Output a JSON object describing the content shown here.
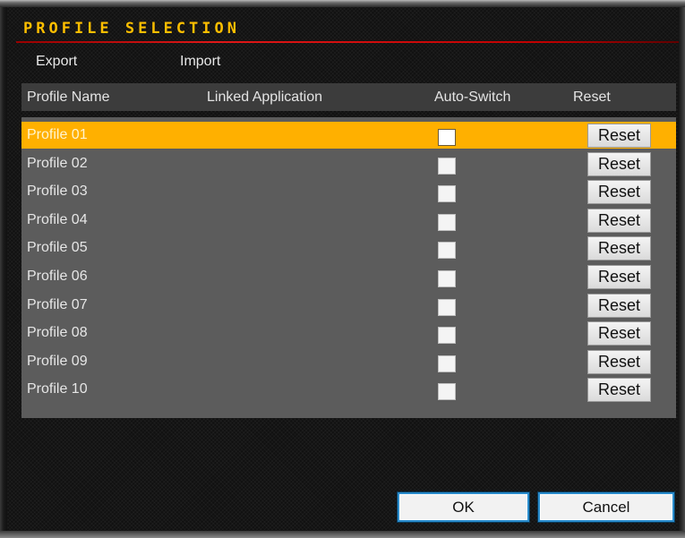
{
  "window": {
    "title": "PROFILE SELECTION"
  },
  "menu": {
    "export_label": "Export",
    "import_label": "Import"
  },
  "columns": {
    "profile_name": "Profile Name",
    "linked_application": "Linked Application",
    "auto_switch": "Auto-Switch",
    "reset": "Reset"
  },
  "rows": [
    {
      "name": "Profile 01",
      "reset_label": "Reset",
      "selected": true,
      "auto_switch": false
    },
    {
      "name": "Profile 02",
      "reset_label": "Reset",
      "selected": false,
      "auto_switch": false
    },
    {
      "name": "Profile 03",
      "reset_label": "Reset",
      "selected": false,
      "auto_switch": false
    },
    {
      "name": "Profile 04",
      "reset_label": "Reset",
      "selected": false,
      "auto_switch": false
    },
    {
      "name": "Profile 05",
      "reset_label": "Reset",
      "selected": false,
      "auto_switch": false
    },
    {
      "name": "Profile 06",
      "reset_label": "Reset",
      "selected": false,
      "auto_switch": false
    },
    {
      "name": "Profile 07",
      "reset_label": "Reset",
      "selected": false,
      "auto_switch": false
    },
    {
      "name": "Profile 08",
      "reset_label": "Reset",
      "selected": false,
      "auto_switch": false
    },
    {
      "name": "Profile 09",
      "reset_label": "Reset",
      "selected": false,
      "auto_switch": false
    },
    {
      "name": "Profile 10",
      "reset_label": "Reset",
      "selected": false,
      "auto_switch": false
    }
  ],
  "footer": {
    "ok_label": "OK",
    "cancel_label": "Cancel"
  },
  "colors": {
    "accent": "#ffb000",
    "title": "#ffbf00",
    "title_rule": "#d01010",
    "table_bg": "#5c5c5c",
    "header_bg": "#3c3c3c",
    "button_border": "#2a8ccc"
  }
}
